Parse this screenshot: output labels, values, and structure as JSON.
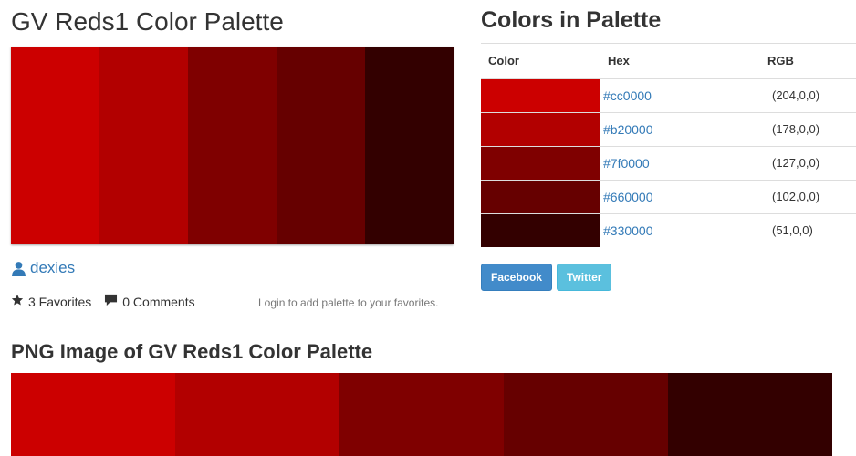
{
  "page": {
    "title": "GV Reds1 Color Palette",
    "author": "dexies",
    "favorites_label": "3 Favorites",
    "comments_label": "0 Comments",
    "login_note": "Login to add palette to your favorites.",
    "png_title": "PNG Image of GV Reds1 Color Palette"
  },
  "colors_section": {
    "title": "Colors in Palette",
    "headers": {
      "color": "Color",
      "hex": "Hex",
      "rgb": "RGB"
    },
    "rows": [
      {
        "hex": "#cc0000",
        "rgb": "(204,0,0)"
      },
      {
        "hex": "#b20000",
        "rgb": "(178,0,0)"
      },
      {
        "hex": "#7f0000",
        "rgb": "(127,0,0)"
      },
      {
        "hex": "#660000",
        "rgb": "(102,0,0)"
      },
      {
        "hex": "#330000",
        "rgb": "(51,0,0)"
      }
    ]
  },
  "share": {
    "facebook_label": "Facebook",
    "twitter_label": "Twitter"
  },
  "icons": {
    "author": "user-icon",
    "favorites": "star-icon",
    "comments": "comment-icon"
  },
  "theme": {
    "link_color": "#337ab7",
    "facebook_color": "#428bca",
    "twitter_color": "#5bc0de"
  }
}
